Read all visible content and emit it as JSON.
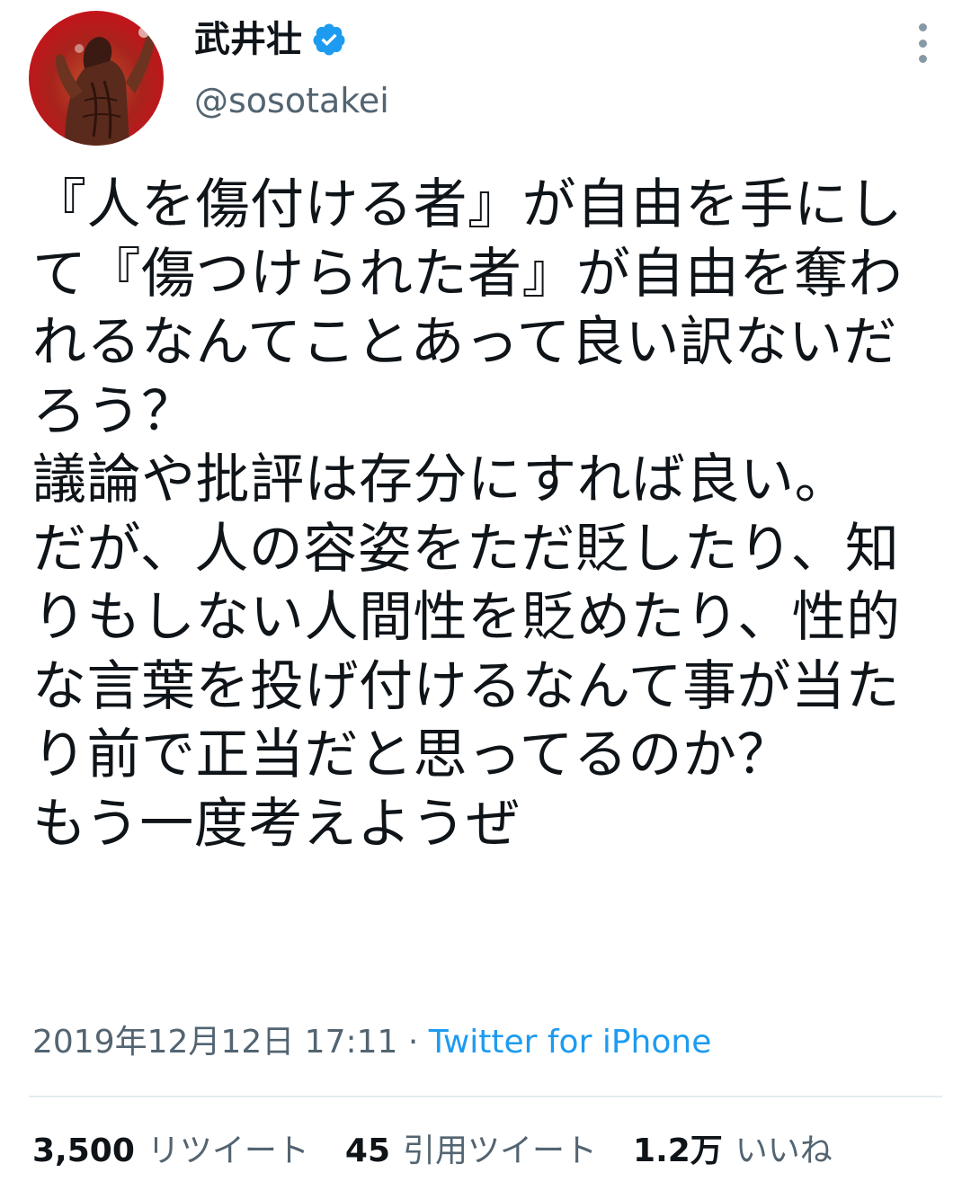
{
  "author": {
    "display_name": "武井壮",
    "handle": "@sosotakei",
    "verified": true,
    "avatar_icon": "profile-photo",
    "verified_icon": "verified-badge-icon",
    "accent_color": "#1d9bf0"
  },
  "tweet": {
    "text": "『人を傷付ける者』が自由を手にして『傷つけられた者』が自由を奪われるなんてことあって良い訳ないだろう？\n議論や批評は存分にすれば良い。\nだが、人の容姿をただ貶したり、知りもしない人間性を貶めたり、性的な言葉を投げ付けるなんて事が当たり前で正当だと思ってるのか？\nもう一度考えようぜ",
    "timestamp": "2019年12月12日 17:11",
    "separator": " · ",
    "source": "Twitter for iPhone"
  },
  "stats": {
    "retweets_count": "3,500",
    "retweets_label": "リツイート",
    "quotes_count": "45",
    "quotes_label": "引用ツイート",
    "likes_count": "1.2万",
    "likes_label": "いいね"
  },
  "menu_icon": "more-vertical-icon"
}
